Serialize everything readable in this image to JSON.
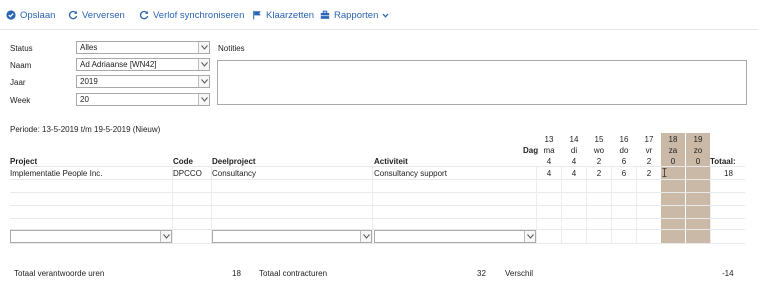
{
  "toolbar": {
    "save": "Opslaan",
    "refresh": "Verversen",
    "sync": "Verlof synchroniseren",
    "ready": "Klaarzetten",
    "reports": "Rapporten"
  },
  "form": {
    "status_label": "Status",
    "status_value": "Alles",
    "name_label": "Naam",
    "name_value": "Ad Adriaanse [WN42]",
    "year_label": "Jaar",
    "year_value": "2019",
    "week_label": "Week",
    "week_value": "20",
    "notes_label": "Notities",
    "notes_value": ""
  },
  "period": "Periode: 13-5-2019 t/m 19-5-2019 (Nieuw)",
  "grid": {
    "day_label": "Dag",
    "dates": [
      "13",
      "14",
      "15",
      "16",
      "17",
      "18",
      "19"
    ],
    "weekdays": [
      "ma",
      "di",
      "wo",
      "do",
      "vr",
      "za",
      "zo"
    ],
    "day_totals": [
      "4",
      "4",
      "2",
      "6",
      "2",
      "0",
      "0"
    ],
    "headers": {
      "project": "Project",
      "code": "Code",
      "subproject": "Deelproject",
      "activity": "Activiteit",
      "total": "Totaal:"
    },
    "rows": [
      {
        "project": "Implementatie People Inc.",
        "code": "DPCCO",
        "subproject": "Consultancy",
        "activity": "Consultancy support",
        "hours": [
          "4",
          "4",
          "2",
          "6",
          "2",
          "",
          ""
        ],
        "total": "18"
      }
    ]
  },
  "footer": {
    "accounted_label": "Totaal verantwoorde uren",
    "accounted_value": "18",
    "contract_label": "Totaal contracturen",
    "contract_value": "32",
    "diff_label": "Verschil",
    "diff_value": "-14"
  },
  "colors": {
    "accent": "#2a64b4",
    "weekend": "#c9b9a6"
  },
  "icons": {
    "save": "check-circle-icon",
    "refresh": "refresh-icon",
    "sync": "sync-icon",
    "ready": "flag-icon",
    "reports": "briefcase-icon",
    "reports_dropdown": "chevron-down-icon"
  }
}
